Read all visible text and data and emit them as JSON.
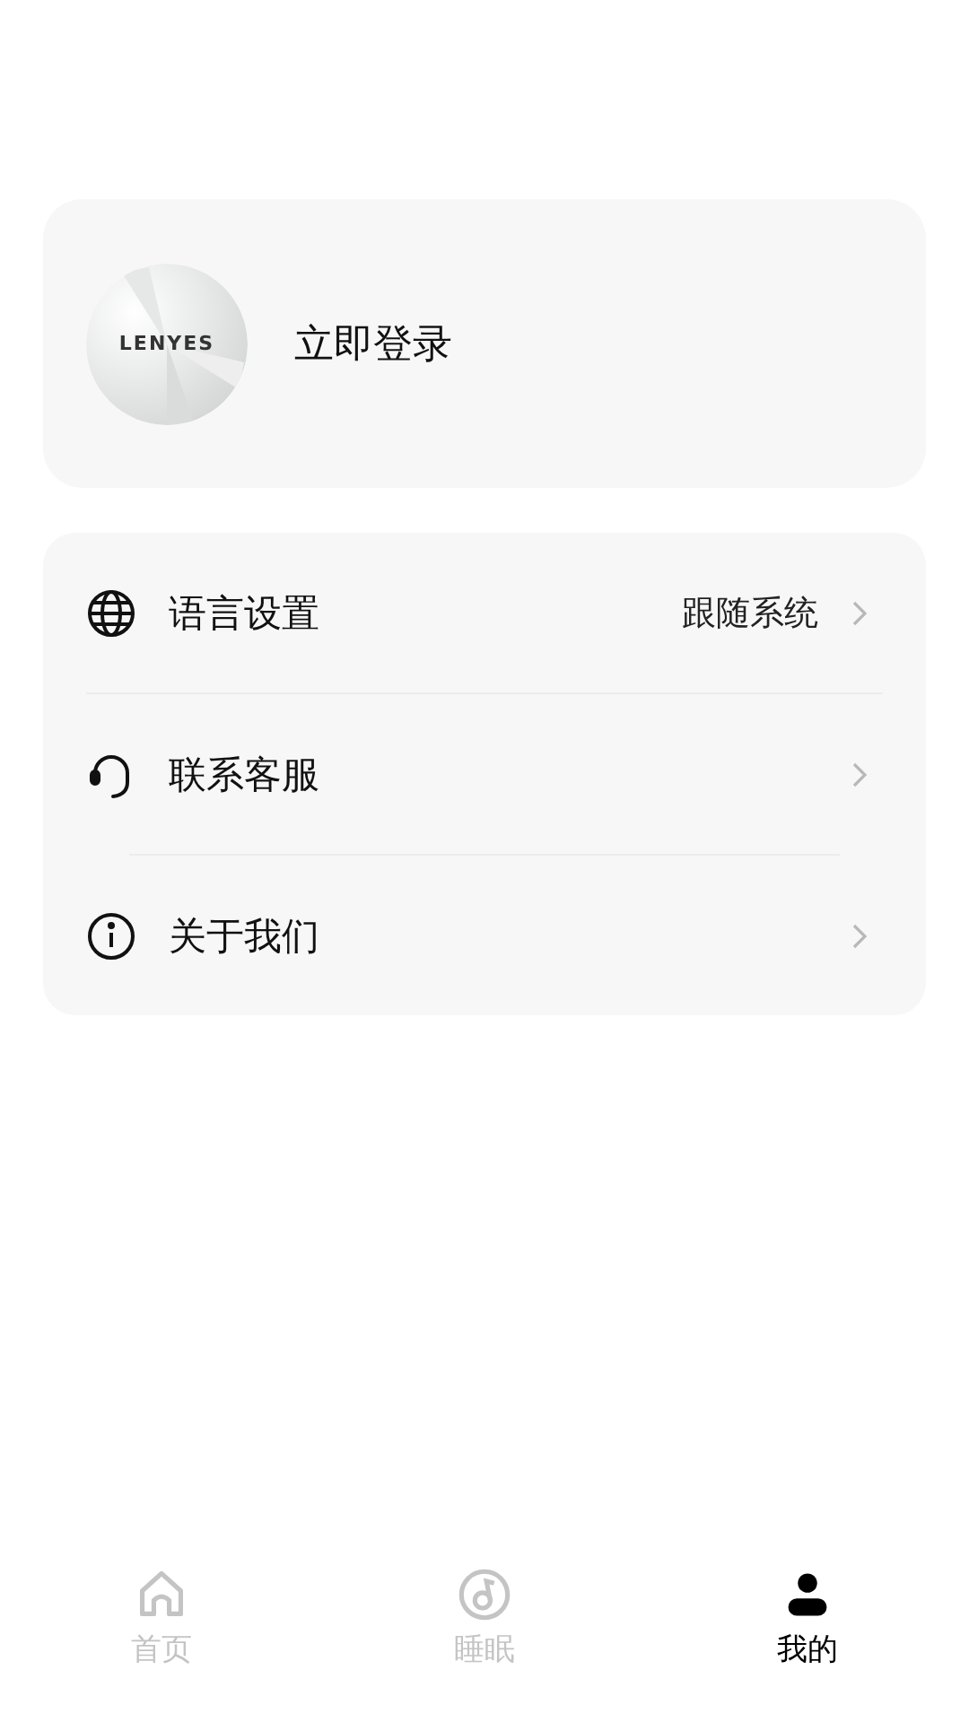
{
  "profile": {
    "logo_text": "LENYES",
    "login_label": "立即登录"
  },
  "menu": [
    {
      "kind": "language",
      "label": "语言设置",
      "value": "跟随系统"
    },
    {
      "kind": "support",
      "label": "联系客服"
    },
    {
      "kind": "about",
      "label": "关于我们"
    }
  ],
  "tab_bar": [
    {
      "kind": "home",
      "label": "首页",
      "selected": false
    },
    {
      "kind": "sleep",
      "label": "睡眠",
      "selected": false
    },
    {
      "kind": "me",
      "label": "我的",
      "selected": true
    }
  ]
}
